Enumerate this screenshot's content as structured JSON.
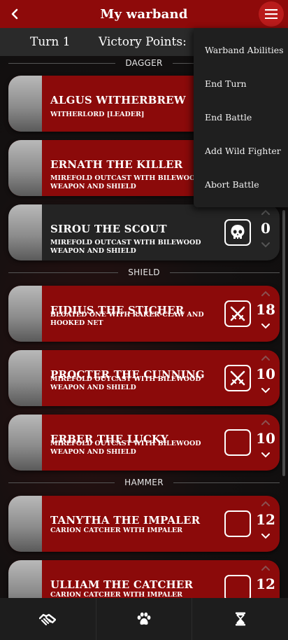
{
  "header": {
    "title": "My warband"
  },
  "status": {
    "turn": "Turn 1",
    "victory_points": "Victory Points:"
  },
  "menu": {
    "items": [
      "Warband Abilities",
      "End Turn",
      "End Battle",
      "Add Wild Fighter",
      "Abort Battle"
    ]
  },
  "sections": {
    "dagger": "DAGGER",
    "shield": "SHIELD",
    "hammer": "HAMMER"
  },
  "fighters": [
    {
      "name": "ALGUS WITHERBREW",
      "type": "WITHERLORD [LEADER]",
      "style": "red",
      "status_icon": "",
      "count": ""
    },
    {
      "name": "ERNATH THE KILLER",
      "type": "MIREFOLD OUTCAST WITH BILEWOOD WEAPON AND SHIELD",
      "style": "red",
      "status_icon": "",
      "count": ""
    },
    {
      "name": "SIROU THE SCOUT",
      "type": "MIREFOLD OUTCAST WITH BILEWOOD WEAPON AND SHIELD",
      "style": "dark",
      "status_icon": "skull-icon",
      "count": "0"
    },
    {
      "name": "FIDIUS THE STICHER",
      "type": "BLOATED ONE WITH RAKER-CLAW AND HOOKED NET",
      "style": "red",
      "status_icon": "crossed-swords-icon",
      "count": "18"
    },
    {
      "name": "PROCTER THE CUNNING",
      "type": "MIREFOLD OUTCAST WITH BILEWOOD WEAPON AND SHIELD",
      "style": "red",
      "status_icon": "crossed-swords-icon",
      "count": "10"
    },
    {
      "name": "ERBER THE LUCKY",
      "type": "MIREFOLD OUTCAST WITH BILEWOOD WEAPON AND SHIELD",
      "style": "red",
      "status_icon": "empty-box-icon",
      "count": "10"
    },
    {
      "name": "TANYTHA THE IMPALER",
      "type": "CARION CATCHER WITH IMPALER",
      "style": "red",
      "status_icon": "empty-box-icon",
      "count": "12"
    },
    {
      "name": "ULLIAM THE CATCHER",
      "type": "CARION CATCHER WITH IMPALER",
      "style": "red",
      "status_icon": "empty-box-icon",
      "count": "12"
    }
  ],
  "colors": {
    "header_red": "#8e0a0a",
    "card_red": "#8b0a0a",
    "card_dark": "#242424",
    "menu_button": "#b91b1b"
  },
  "bottom_tabs": [
    {
      "icon": "handshake-icon"
    },
    {
      "icon": "paw-icon"
    },
    {
      "icon": "hourglass-icon"
    }
  ]
}
